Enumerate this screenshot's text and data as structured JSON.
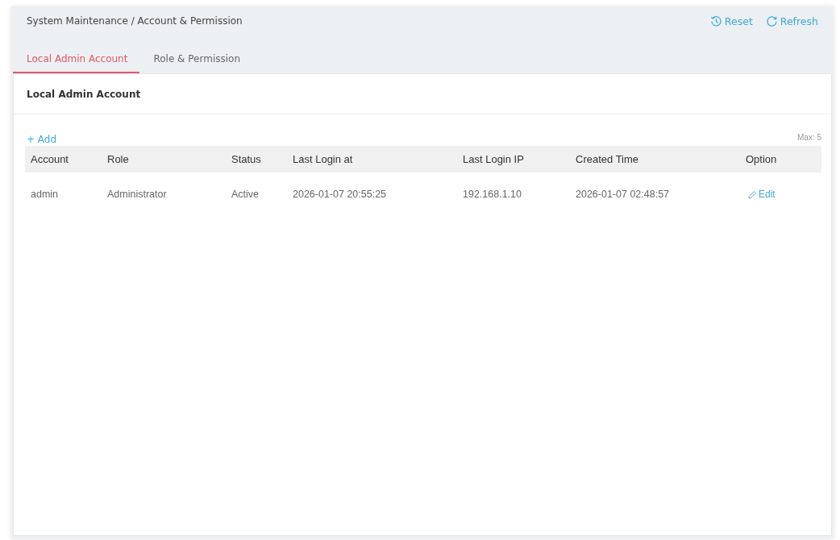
{
  "breadcrumb": "System Maintenance / Account & Permission",
  "header_actions": [
    {
      "kind": "reset",
      "label": "Reset"
    },
    {
      "kind": "refresh",
      "label": "Refresh"
    }
  ],
  "tabs": [
    {
      "label": "Local Admin Account",
      "selected": true
    },
    {
      "label": "Role & Permission",
      "selected": false
    }
  ],
  "card": {
    "title": "Local Admin Account",
    "add_label": "+ Add",
    "max_label": "Max: 5"
  },
  "table": {
    "columns": [
      "Account",
      "Role",
      "Status",
      "Last Login at",
      "Last Login IP",
      "Created Time",
      "Option"
    ],
    "rows": [
      {
        "cells": [
          "admin",
          "Administrator",
          "Active",
          "2026-01-07 20:55:25",
          "192.168.1.10",
          "2026-01-07 02:48:57"
        ],
        "option": "Edit"
      }
    ]
  }
}
